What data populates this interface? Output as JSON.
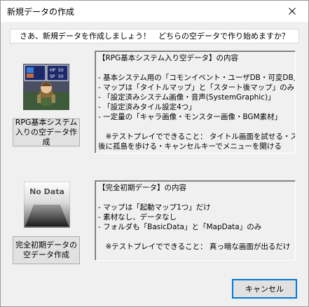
{
  "window": {
    "title": "新規データの作成"
  },
  "prompt": "さあ、新規データを作成しましょう！　どちらの空データで作り始めますか？",
  "rpg_option": {
    "button_label": "RPG基本システム\n入りの空データ作成",
    "preview_hud": [
      "HP",
      "50",
      "SP",
      "50"
    ],
    "desc_lines": [
      "【RPG基本システム入り空データ】の内容",
      "",
      "- 基本システム用の「コモンイベント・ユーザDB・可変DB」",
      "- マップは「タイトルマップ」と「スタート後マップ」のみ",
      "- 「設定済みシステム画像・音声(SystemGraphic)」",
      "- 「設定済みタイル設定4つ」",
      "- 一定量の「キャラ画像・モンスター画像・BGM素材」",
      "",
      "　※テストプレイでできること： タイトル画面を試せる・スタート",
      "後に孤島を歩ける・キャンセルキーでメニューを開ける"
    ]
  },
  "nodata_option": {
    "button_label": "完全初期データの\n空データ作成",
    "preview_text": "No Data",
    "desc_lines": [
      "【完全初期データ】の内容",
      "",
      "- マップは「起動マップ1つ」だけ",
      "- 素材なし、データなし",
      "- フォルダも「BasicData」と「MapData」のみ",
      "",
      "　※テストプレイでできること： 真っ暗な画面が出るだけ"
    ]
  },
  "cancel_label": "キャンセル",
  "colors": {
    "focus_border": "#0078d7",
    "face": "#f0f0f0",
    "button_face": "#e1e1e1"
  },
  "icons": {
    "close": "close-icon"
  }
}
